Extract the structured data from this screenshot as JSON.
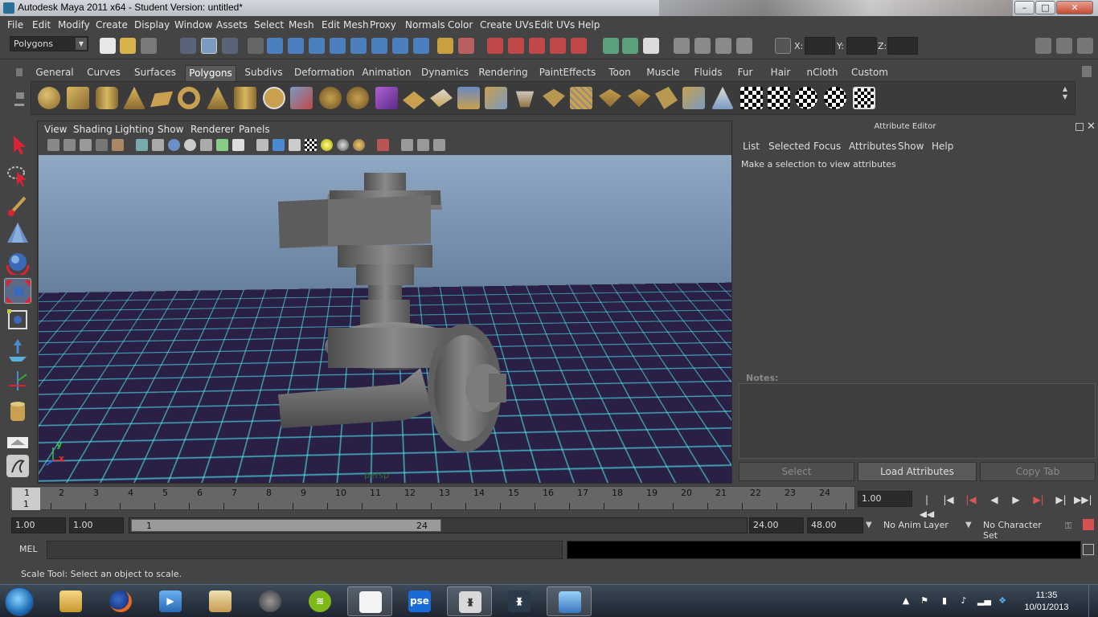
{
  "window": {
    "title": "Autodesk Maya 2011 x64 - Student Version: untitled*",
    "minimize": "–",
    "maximize": "□",
    "close": "✕"
  },
  "menubar": [
    "File",
    "Edit",
    "Modify",
    "Create",
    "Display",
    "Window",
    "Assets",
    "Select",
    "Mesh",
    "Edit Mesh",
    "Proxy",
    "Normals",
    "Color",
    "Create UVs",
    "Edit UVs",
    "Help"
  ],
  "statusline": {
    "mode": "Polygons",
    "x_label": "X:",
    "y_label": "Y:",
    "z_label": "Z:"
  },
  "shelf": {
    "tabs": [
      "General",
      "Curves",
      "Surfaces",
      "Polygons",
      "Subdivs",
      "Deformation",
      "Animation",
      "Dynamics",
      "Rendering",
      "PaintEffects",
      "Toon",
      "Muscle",
      "Fluids",
      "Fur",
      "Hair",
      "nCloth",
      "Custom"
    ],
    "active_tab": "Polygons"
  },
  "panel": {
    "menu": [
      "View",
      "Shading",
      "Lighting",
      "Show",
      "Renderer",
      "Panels"
    ],
    "camera": "persp",
    "axis_x": "x",
    "axis_y": "y"
  },
  "attribute_editor": {
    "title": "Attribute Editor",
    "menu": [
      "List",
      "Selected",
      "Focus",
      "Attributes",
      "Show",
      "Help"
    ],
    "message": "Make a selection to view attributes",
    "notes_label": "Notes:",
    "buttons": {
      "select": "Select",
      "load": "Load Attributes",
      "copy": "Copy Tab"
    }
  },
  "timeline": {
    "ticks": [
      "1",
      "2",
      "3",
      "4",
      "5",
      "6",
      "7",
      "8",
      "9",
      "10",
      "11",
      "12",
      "13",
      "14",
      "15",
      "16",
      "17",
      "18",
      "19",
      "20",
      "21",
      "22",
      "23",
      "24"
    ],
    "current_frame_marker": "1",
    "current_frame": "1.00"
  },
  "range": {
    "start_time": "1.00",
    "playback_start": "1.00",
    "range_start_label": "1",
    "range_end_label": "24",
    "playback_end": "24.00",
    "end_time": "48.00",
    "anim_layer": "No Anim Layer",
    "character_set": "No Character Set"
  },
  "command_line": {
    "label": "MEL"
  },
  "help_line": "Scale Tool: Select an object to scale.",
  "taskbar": {
    "pse_label": "pse",
    "clock_time": "11:35",
    "clock_date": "10/01/2013"
  },
  "colors": {
    "maya_bg": "#444444",
    "grid": "#4ee6f0",
    "ground": "#2a1f44"
  }
}
